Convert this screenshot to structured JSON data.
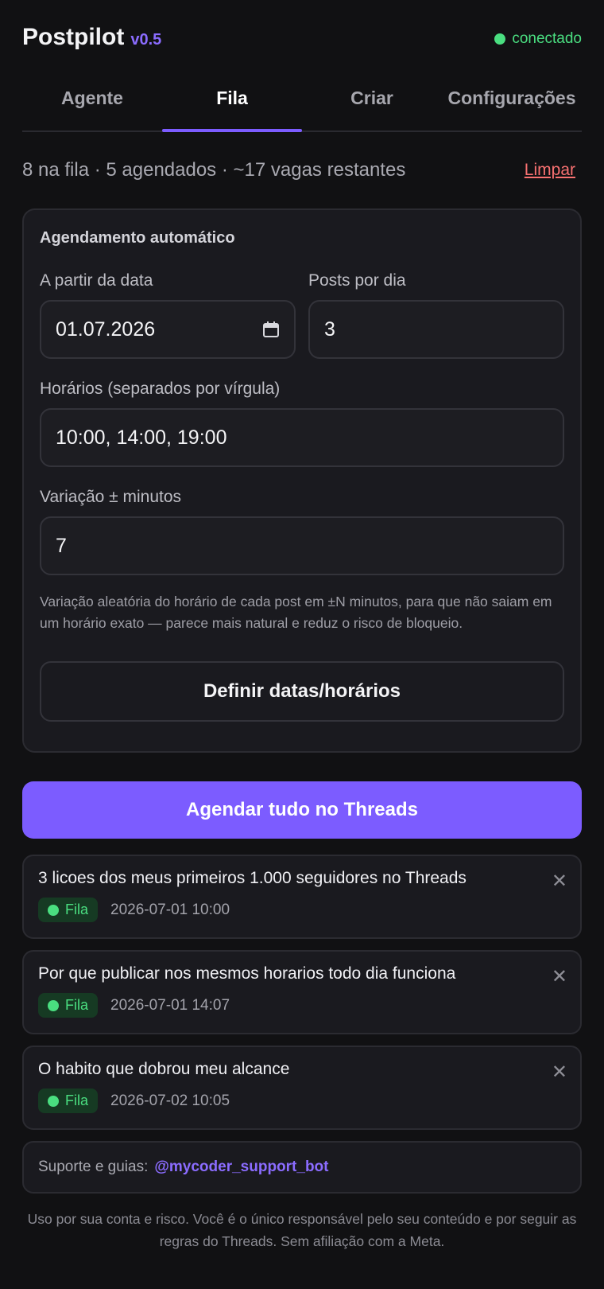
{
  "header": {
    "app_name": "Postpilot",
    "version": "v0.5",
    "status": "conectado",
    "status_color": "#4ade80",
    "accent_color": "#7c5cff"
  },
  "tabs": [
    {
      "label": "Agente",
      "active": false
    },
    {
      "label": "Fila",
      "active": true
    },
    {
      "label": "Criar",
      "active": false
    },
    {
      "label": "Configurações",
      "active": false
    }
  ],
  "summary": {
    "text": "8 na fila · 5 agendados · ~17 vagas restantes",
    "clear_label": "Limpar"
  },
  "auto_schedule": {
    "title": "Agendamento automático",
    "start_date_label": "A partir da data",
    "start_date_value": "01.07.2026",
    "posts_per_day_label": "Posts por dia",
    "posts_per_day_value": "3",
    "times_label": "Horários (separados por vírgula)",
    "times_value": "10:00, 14:00, 19:00",
    "variation_label": "Variação ± minutos",
    "variation_value": "7",
    "hint": "Variação aleatória do horário de cada post em ±N minutos, para que não saiam em um horário exato — parece mais natural e reduz o risco de bloqueio.",
    "set_button": "Definir datas/horários"
  },
  "primary_button": "Agendar tudo no Threads",
  "queue": [
    {
      "title": "3 licoes dos meus primeiros 1.000 seguidores no Threads",
      "status": "Fila",
      "time": "2026-07-01 10:00"
    },
    {
      "title": "Por que publicar nos mesmos horarios todo dia funciona",
      "status": "Fila",
      "time": "2026-07-01 14:07"
    },
    {
      "title": "O habito que dobrou meu alcance",
      "status": "Fila",
      "time": "2026-07-02 10:05"
    }
  ],
  "support": {
    "label": "Suporte e guias:",
    "handle": "@mycoder_support_bot"
  },
  "disclaimer": "Uso por sua conta e risco. Você é o único responsável pelo seu conteúdo e por seguir as regras do Threads. Sem afiliação com a Meta.",
  "icons": {
    "calendar": "calendar-icon",
    "close": "close-icon",
    "status_dot": "status-dot-icon"
  }
}
